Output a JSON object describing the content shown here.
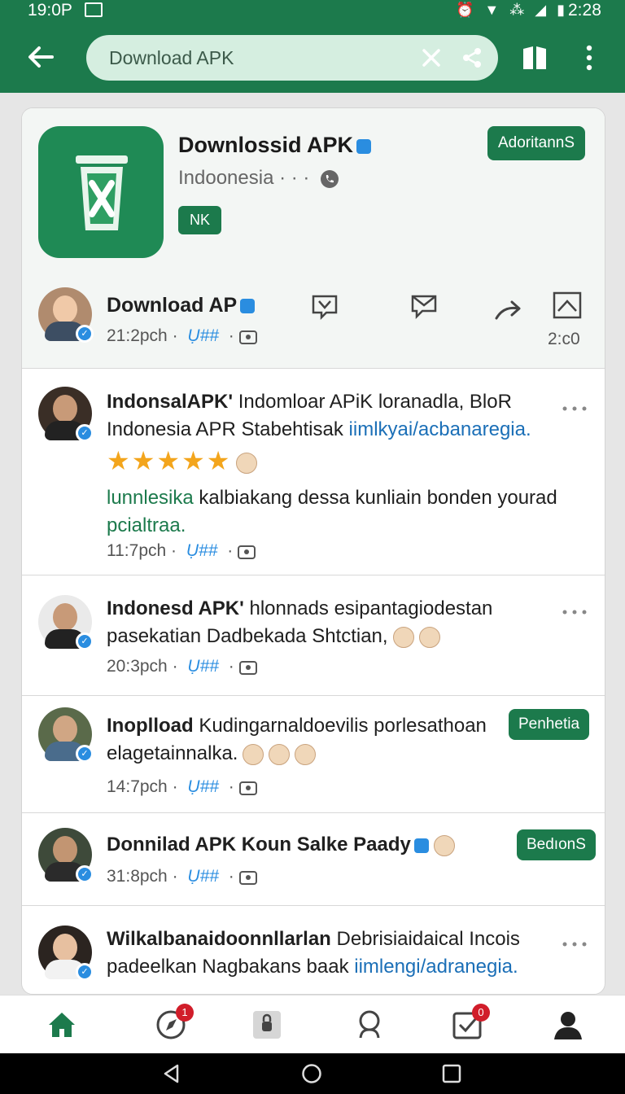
{
  "status_bar": {
    "time_left": "19:0P",
    "time_right": "2:28",
    "icons": "⏰ ▼ ⁂ ◢ ▮"
  },
  "app_bar": {
    "search_text": "Download APK"
  },
  "app_header": {
    "title": "Downlossid APK",
    "subtitle": "Indoonesia · · ·",
    "chip": "NK",
    "action_button": "AdoritannS"
  },
  "pinned": {
    "name": "Download AP",
    "time": "21:2pch",
    "tag": "Ụ##",
    "count": "2:c0"
  },
  "posts": [
    {
      "name": "IndonsalAPK'",
      "text": " Indomloar APiK loranadla, BloR Indonesia APR Stabehtisak ",
      "link": "iimlkyai/acbanaregia.",
      "body_green": "lunnlesika",
      "body": " kalbiakang dessa kunliain bonden yourad ",
      "body_green2": "pcialtraa.",
      "time": "11:7pch",
      "tag": "Ụ##",
      "stars": "★★★★★"
    },
    {
      "name": "Indonesd APK'",
      "text": " hlonnads esipantagiodestan pasekatian Dadbekada Shtctian,",
      "time": "20:3pch",
      "tag": "Ụ##"
    },
    {
      "name": "Inoplload",
      "text": " Kudingarnaldoevilis porlesathoan elagetainnalka.",
      "time": "14:7pch",
      "tag": "Ụ##",
      "chip": "Penhetiа"
    },
    {
      "name": "Donnilad APK Koun Salke Paady",
      "time": "31:8pch",
      "tag": "Ụ##",
      "chip": "BedıonS"
    },
    {
      "name": "Wilkalbanaidoonnllarlan",
      "text": " Debrisiaidaical Incois padeelkan Nagbakans baak ",
      "link": "iimlengi/adranegia."
    }
  ],
  "bottom_nav": {
    "badge_explore": "1",
    "badge_tasks": "0"
  },
  "colors": {
    "brand_green": "#1c7a4c",
    "link_blue": "#1b6fb7",
    "badge_red": "#d11d2a"
  }
}
